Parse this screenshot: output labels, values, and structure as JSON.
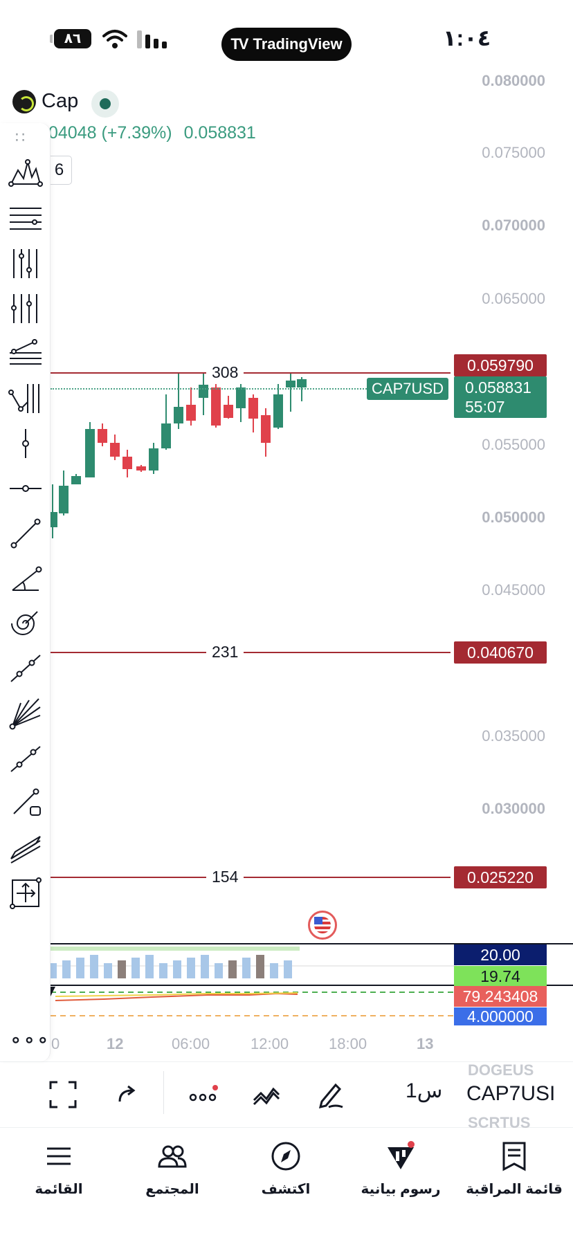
{
  "status_bar": {
    "battery": "٨٦",
    "time": "١:٠٤",
    "app_badge": "TradingView",
    "app_badge_logo": "TV"
  },
  "chart_header": {
    "symbol_short": "Cap",
    "change": "04048 (+7.39%)",
    "last_price": "0.058831",
    "drawings_count": "6"
  },
  "toolbar": {
    "drag_handle": "∷",
    "more": "∘∘∘",
    "tools": [
      "pattern-tool-icon",
      "horizontal-lines-icon",
      "vertical-lines-icon",
      "parallel-vertical-icon",
      "fib-fan-icon",
      "elliott-wave-icon",
      "vertical-line-icon",
      "horizontal-ray-icon",
      "trend-line-icon",
      "trend-angle-icon",
      "fib-spiral-icon",
      "info-line-icon",
      "fan-lines-icon",
      "extended-line-icon",
      "ray-icon",
      "parallel-channel-icon",
      "measure-icon"
    ]
  },
  "price_axis": {
    "labels": [
      {
        "text": "0.080000",
        "bold": true
      },
      {
        "text": "0.075000",
        "bold": false
      },
      {
        "text": "0.070000",
        "bold": true
      },
      {
        "text": "0.065000",
        "bold": false
      },
      {
        "text": "0.055000",
        "bold": false
      },
      {
        "text": "0.050000",
        "bold": true
      },
      {
        "text": "0.045000",
        "bold": false
      },
      {
        "text": "0.035000",
        "bold": false
      },
      {
        "text": "0.030000",
        "bold": true
      }
    ]
  },
  "levels": [
    {
      "count": "308",
      "price": "0.059790"
    },
    {
      "count": "231",
      "price": "0.040670"
    },
    {
      "count": "154",
      "price": "0.025220"
    }
  ],
  "last_price_tag": {
    "symbol": "CAP7USD",
    "price": "0.058831",
    "countdown": "55:07"
  },
  "indicators": {
    "adx_level": "20.00",
    "adx_value": "19.74",
    "osc_value": "79.243408",
    "osc_level": "4.000000"
  },
  "time_axis": [
    {
      "text": "0",
      "bold": false
    },
    {
      "text": "12",
      "bold": true
    },
    {
      "text": "06:00",
      "bold": false
    },
    {
      "text": "12:00",
      "bold": false
    },
    {
      "text": "18:00",
      "bold": false
    },
    {
      "text": "13",
      "bold": true
    }
  ],
  "chart_bar": {
    "interval": "1س",
    "symbol_prev": "DOGEUS",
    "symbol_current": "CAP7USI",
    "symbol_next": "SCRTUS"
  },
  "bottom_nav": [
    {
      "label": "القائمة",
      "icon": "menu-icon"
    },
    {
      "label": "المجتمع",
      "icon": "community-icon"
    },
    {
      "label": "اكتشف",
      "icon": "compass-icon"
    },
    {
      "label": "رسوم بيانية",
      "icon": "chart-icon"
    },
    {
      "label": "قائمة المراقبة",
      "icon": "watchlist-icon"
    }
  ],
  "colors": {
    "up": "#2e8b6f",
    "down": "#e0414b",
    "level": "#a42a32",
    "axis_text": "#b2b5be"
  }
}
